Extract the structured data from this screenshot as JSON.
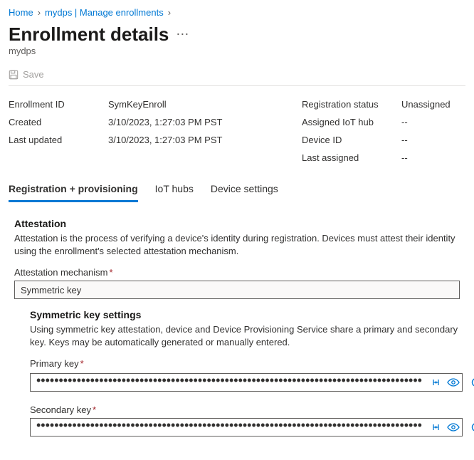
{
  "breadcrumb": {
    "home": "Home",
    "path1": "mydps | Manage enrollments"
  },
  "page": {
    "title": "Enrollment details",
    "subtitle": "mydps"
  },
  "toolbar": {
    "save_label": "Save"
  },
  "details": {
    "left": [
      {
        "label": "Enrollment ID",
        "value": "SymKeyEnroll"
      },
      {
        "label": "Created",
        "value": "3/10/2023, 1:27:03 PM PST"
      },
      {
        "label": "Last updated",
        "value": "3/10/2023, 1:27:03 PM PST"
      }
    ],
    "right": [
      {
        "label": "Registration status",
        "value": "Unassigned"
      },
      {
        "label": "Assigned IoT hub",
        "value": "--"
      },
      {
        "label": "Device ID",
        "value": "--"
      },
      {
        "label": "Last assigned",
        "value": "--"
      }
    ]
  },
  "tabs": {
    "t0": "Registration + provisioning",
    "t1": "IoT hubs",
    "t2": "Device settings"
  },
  "attestation": {
    "heading": "Attestation",
    "desc": "Attestation is the process of verifying a device's identity during registration. Devices must attest their identity using the enrollment's selected attestation mechanism.",
    "mechanism_label": "Attestation mechanism",
    "mechanism_value": "Symmetric key"
  },
  "symkey": {
    "heading": "Symmetric key settings",
    "desc": "Using symmetric key attestation, device and Device Provisioning Service share a primary and secondary key. Keys may be automatically generated or manually entered.",
    "primary_label": "Primary key",
    "secondary_label": "Secondary key",
    "masked_value": "••••••••••••••••••••••••••••••••••••••••••••••••••••••••••••••••••••••••••••••••••••••"
  }
}
